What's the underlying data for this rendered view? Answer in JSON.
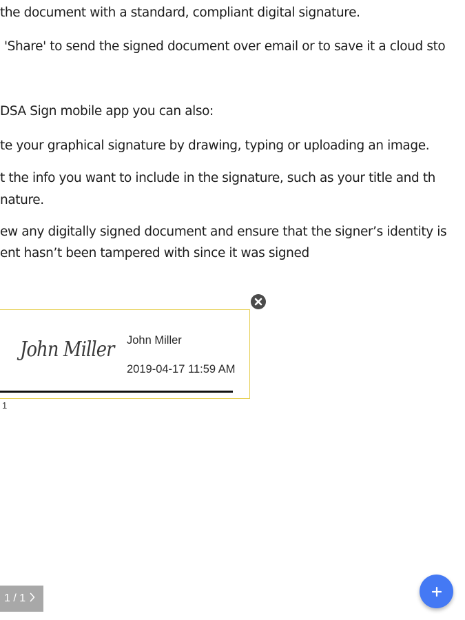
{
  "document": {
    "lines": [
      "the document with a standard, compliant digital signature.",
      "'Share' to send the signed document over email or to save it a cloud sto",
      "DSA Sign mobile app you can also:",
      "te your graphical signature by drawing, typing or uploading an image.",
      "t the info you want to include in the signature, such as your title and th",
      "nature.",
      "ew any digitally signed document and ensure that the signer’s identity is",
      "ent hasn’t been tampered with since it was signed"
    ]
  },
  "signature": {
    "script_name": "John Miller",
    "signer_name": "John Miller",
    "timestamp": "2019-04-17 11:59 AM",
    "caption": "1",
    "border_color": "#e6cf52"
  },
  "controls": {
    "close_icon": "close-circle-icon",
    "page_indicator": "1 / 1",
    "next_icon": "chevron-right-icon",
    "fab_icon": "plus-icon",
    "fab_color": "#4479f4"
  }
}
